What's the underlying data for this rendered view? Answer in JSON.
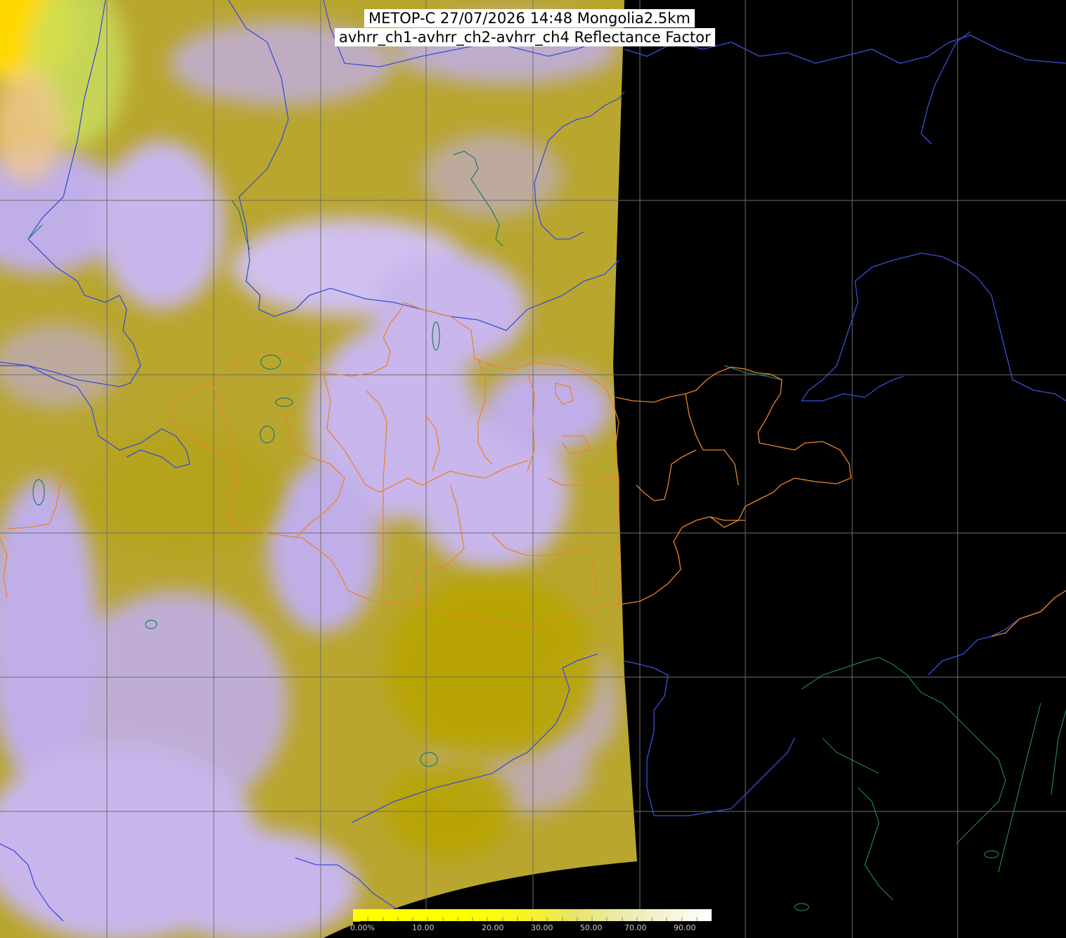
{
  "title": {
    "line1": "METOP-C 27/07/2026 14:48 Mongolia2.5km",
    "line2": "avhrr_ch1-avhrr_ch2-avhrr_ch4 Reflectance Factor"
  },
  "colors": {
    "background": "#000000",
    "surface_yellow": "#b9a62e",
    "cloud_lavender": "#c0aee8",
    "cloud_pale": "#d8c8f5",
    "grid": "#7a7a7a",
    "country_border": "#3a4fd8",
    "coast_water": "#1f6f6a",
    "province_border": "#e8862a",
    "title_bg": "#ffffff"
  },
  "colorbar": {
    "labels": [
      "0.00%",
      "10.00",
      "20.00",
      "30.00",
      "50.00",
      "70.00",
      "90.00"
    ],
    "ramp_colors": [
      "#ffff00",
      "#ffff00",
      "#f6f22a",
      "#e8e46a",
      "#eceaa8",
      "#f4f2d2",
      "#ffffff"
    ]
  }
}
